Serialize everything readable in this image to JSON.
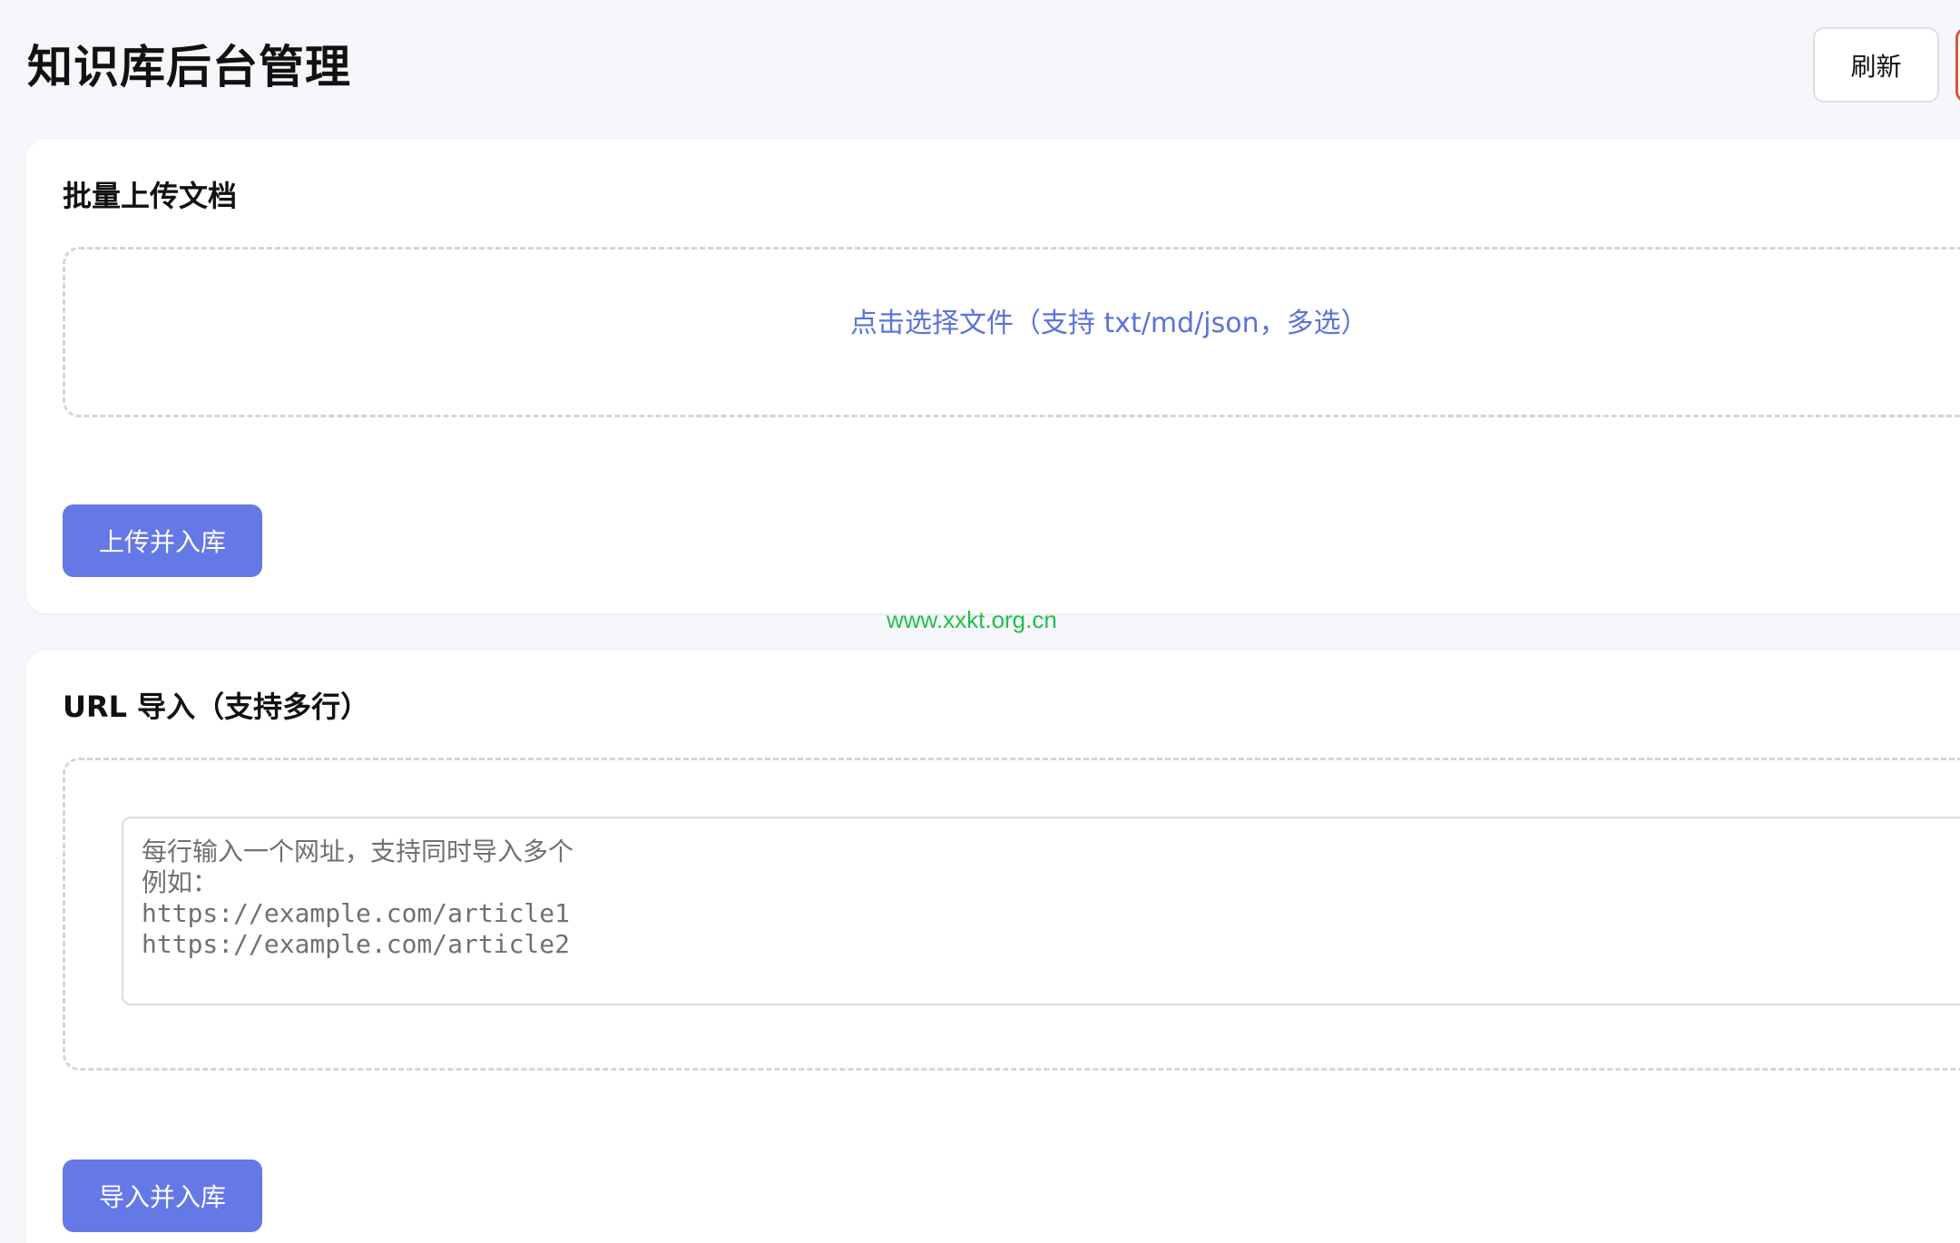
{
  "header": {
    "title": "知识库后台管理",
    "refresh_label": "刷新"
  },
  "upload": {
    "title": "批量上传文档",
    "dropzone_text": "点击选择文件（支持 txt/md/json，多选）",
    "submit_label": "上传并入库"
  },
  "url_import": {
    "title": "URL 导入（支持多行）",
    "placeholder": "每行输入一个网址，支持同时导入多个\n例如：\nhttps://example.com/article1\nhttps://example.com/article2",
    "value": "",
    "submit_label": "导入并入库"
  },
  "watermark": {
    "text": "www.xxkt.org.cn"
  },
  "colors": {
    "primary": "#6478e6",
    "link": "#5b72dc",
    "watermark": "#1fc14a",
    "background": "#f6f7fb"
  }
}
